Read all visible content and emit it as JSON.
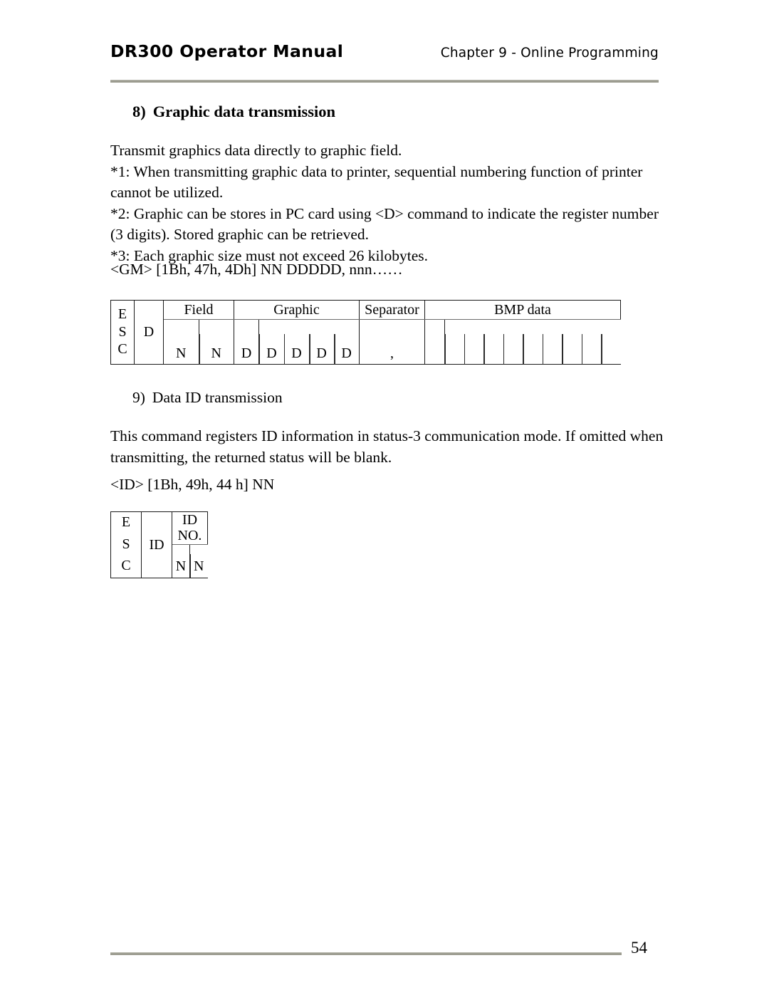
{
  "header": {
    "title": "DR300 Operator Manual",
    "chapter": "Chapter 9 - Online Programming"
  },
  "sections": [
    {
      "number": "8)",
      "heading": "Graphic data transmission",
      "paragraphs": [
        "Transmit graphics data directly to graphic field.",
        "*1: When transmitting graphic data to printer, sequential numbering function of printer cannot be utilized.",
        "*2: Graphic can be stores in PC card using <D> command to indicate the register number (3 digits).  Stored graphic can be retrieved.",
        "*3: Each graphic size must not exceed 26 kilobytes."
      ],
      "command": "<GM> [1Bh, 47h, 4Dh]  NN  DDDDD,  nnn……"
    },
    {
      "number": "9)",
      "heading": "Data ID transmission",
      "paragraphs": [
        "This command registers ID information in status-3 communication mode.  If omitted when transmitting, the returned status will be blank."
      ],
      "command": "<ID> [1Bh, 49h, 44 h]  NN"
    }
  ],
  "table1": {
    "esc_chars": [
      "E",
      "S",
      "C"
    ],
    "command_char": "D",
    "groups": [
      {
        "label": "Field",
        "cells": [
          "N",
          "N"
        ]
      },
      {
        "label": "Graphic",
        "cells": [
          "D",
          "D",
          "D",
          "D",
          "D"
        ]
      },
      {
        "label": "Separator",
        "cells": [
          ","
        ]
      },
      {
        "label": "BMP data",
        "cells": [
          "",
          "",
          "",
          "",
          "",
          "",
          "",
          "",
          "",
          ""
        ]
      }
    ]
  },
  "table2": {
    "esc_chars": [
      "E",
      "S",
      "C"
    ],
    "command_label": "ID",
    "group_label_line1": "ID",
    "group_label_line2": "NO.",
    "cells": [
      "N",
      "N"
    ]
  },
  "footer": {
    "page_number": "54"
  }
}
